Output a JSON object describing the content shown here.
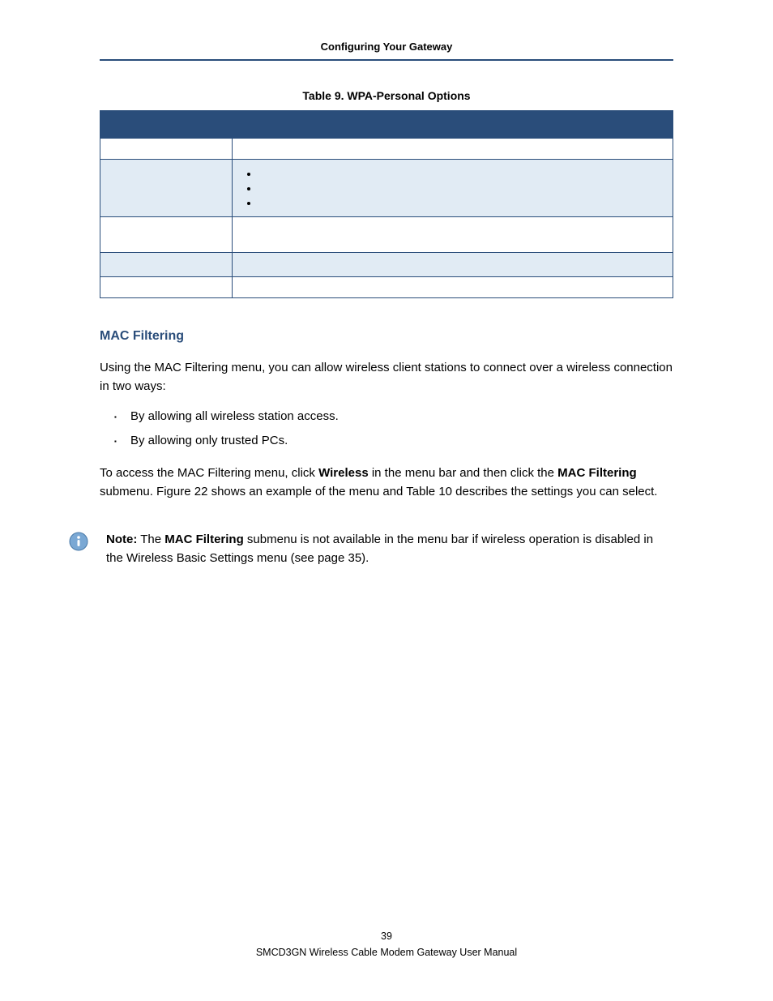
{
  "header": {
    "title": "Configuring Your Gateway"
  },
  "table": {
    "caption": "Table 9. WPA-Personal Options",
    "rows": [
      {
        "option": "",
        "desc": ""
      },
      {
        "option": "",
        "desc": "",
        "items": [
          "",
          "",
          ""
        ]
      },
      {
        "option": "",
        "desc": ""
      },
      {
        "option": "",
        "desc": ""
      },
      {
        "option": "",
        "desc": ""
      }
    ]
  },
  "section": {
    "heading": "MAC Filtering",
    "intro": "Using the MAC Filtering menu, you can allow wireless client stations to connect over a wireless connection in two ways:",
    "bullets": [
      "By allowing all wireless station access.",
      "By allowing only trusted PCs."
    ],
    "access_pre": "To access the MAC Filtering menu, click ",
    "access_bold1": "Wireless",
    "access_mid": " in the menu bar and then click the ",
    "access_bold2": "MAC Filtering",
    "access_post": " submenu. Figure 22 shows an example of the menu and Table 10 describes the settings you can select."
  },
  "note": {
    "label": "Note:",
    "pre": " The ",
    "bold": "MAC Filtering",
    "post": " submenu is not available in the menu bar if wireless operation is disabled in the Wireless Basic Settings menu (see page 35)."
  },
  "footer": {
    "page_number": "39",
    "manual_title": "SMCD3GN Wireless Cable Modem Gateway User Manual"
  }
}
